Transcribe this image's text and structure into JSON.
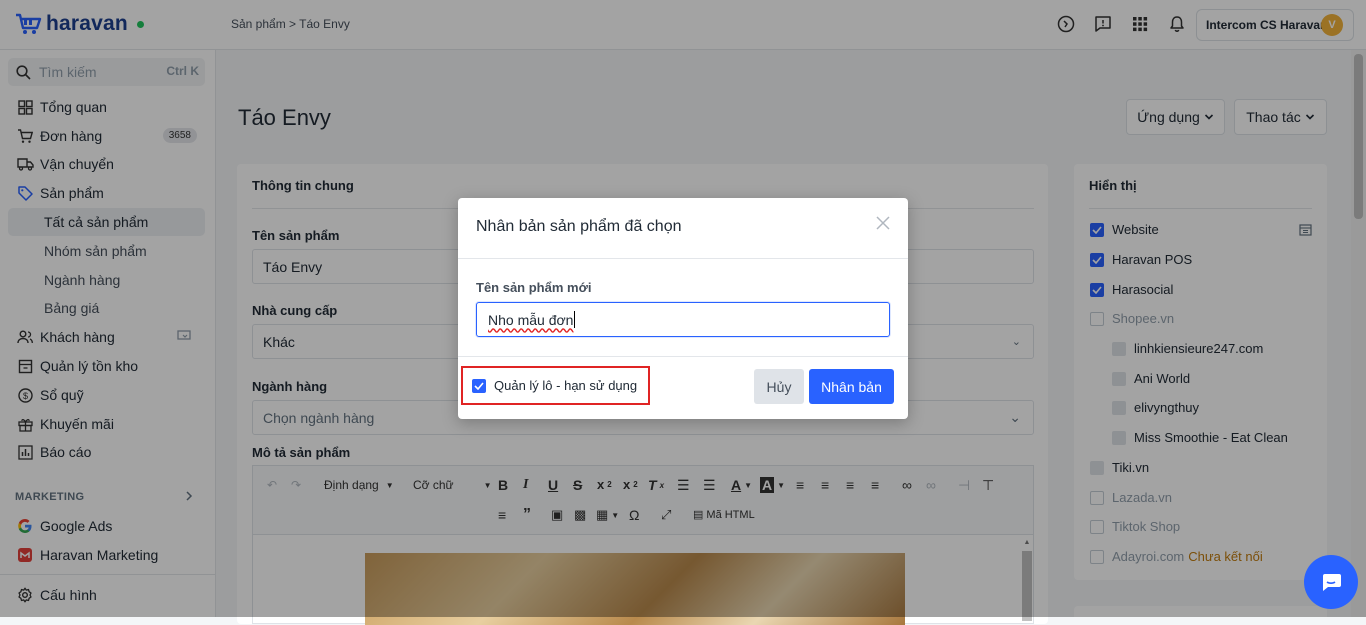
{
  "header": {
    "brand": "haravan",
    "breadcrumb": "Sản phẩm > Táo Envy",
    "icons": [
      "help-icon",
      "chat-icon",
      "apps-icon",
      "bell-icon"
    ],
    "account_name": "Intercom CS Haravan",
    "avatar_letter": "V"
  },
  "sidebar": {
    "search_placeholder": "Tìm kiếm",
    "search_shortcut": "Ctrl K",
    "items": [
      {
        "label": "Tổng quan"
      },
      {
        "label": "Đơn hàng",
        "badge": "3658"
      },
      {
        "label": "Vận chuyển"
      },
      {
        "label": "Sản phẩm"
      },
      {
        "label": "Tất cả sản phẩm"
      },
      {
        "label": "Nhóm sản phẩm"
      },
      {
        "label": "Ngành hàng"
      },
      {
        "label": "Bảng giá"
      },
      {
        "label": "Khách hàng"
      },
      {
        "label": "Quản lý tồn kho"
      },
      {
        "label": "Sổ quỹ"
      },
      {
        "label": "Khuyến mãi"
      },
      {
        "label": "Báo cáo"
      }
    ],
    "marketing_title": "MARKETING",
    "marketing_items": [
      {
        "label": "Google Ads"
      },
      {
        "label": "Haravan Marketing"
      }
    ],
    "settings_label": "Cấu hình"
  },
  "main": {
    "title": "Táo Envy",
    "apps_button": "Ứng dụng",
    "actions_button": "Thao tác",
    "general_card_title": "Thông tin chung",
    "name_label": "Tên sản phẩm",
    "name_value": "Táo Envy",
    "supplier_label": "Nhà cung cấp",
    "supplier_value": "Khác",
    "category_label": "Ngành hàng",
    "category_placeholder": "Chọn ngành hàng",
    "description_label": "Mô tả sản phẩm",
    "toolbar": {
      "format_label": "Định dạng",
      "size_label": "Cỡ chữ",
      "html_label": "Mã HTML"
    }
  },
  "visibility": {
    "title": "Hiển thị",
    "channels": [
      {
        "label": "Website",
        "checked": true
      },
      {
        "label": "Haravan POS",
        "checked": true
      },
      {
        "label": "Harasocial",
        "checked": true
      },
      {
        "label": "Shopee.vn",
        "checked": false
      },
      {
        "label": "linhkiensieure247.com",
        "checked": false
      },
      {
        "label": "Ani World",
        "checked": false
      },
      {
        "label": "elivyngthuy",
        "checked": false
      },
      {
        "label": "Miss Smoothie - Eat Clean",
        "checked": false
      },
      {
        "label": "Tiki.vn",
        "checked": false
      },
      {
        "label": "Lazada.vn",
        "checked": false
      },
      {
        "label": "Tiktok Shop",
        "checked": false
      },
      {
        "label": "Adayroi.com",
        "checked": false,
        "note": "Chưa kết nối"
      }
    ],
    "note_color": "#c27c0e"
  },
  "modal": {
    "title": "Nhân bản sản phẩm đã chọn",
    "field_label": "Tên sản phẩm mới",
    "field_value": "Nho mẫu đơn",
    "checkbox_label": "Quản lý lô - hạn sử dụng",
    "checkbox_checked": true,
    "cancel_label": "Hủy",
    "confirm_label": "Nhân bản"
  },
  "colors": {
    "primary": "#2962ff",
    "highlight_border": "#e02424",
    "brand": "#1d3f8f"
  }
}
